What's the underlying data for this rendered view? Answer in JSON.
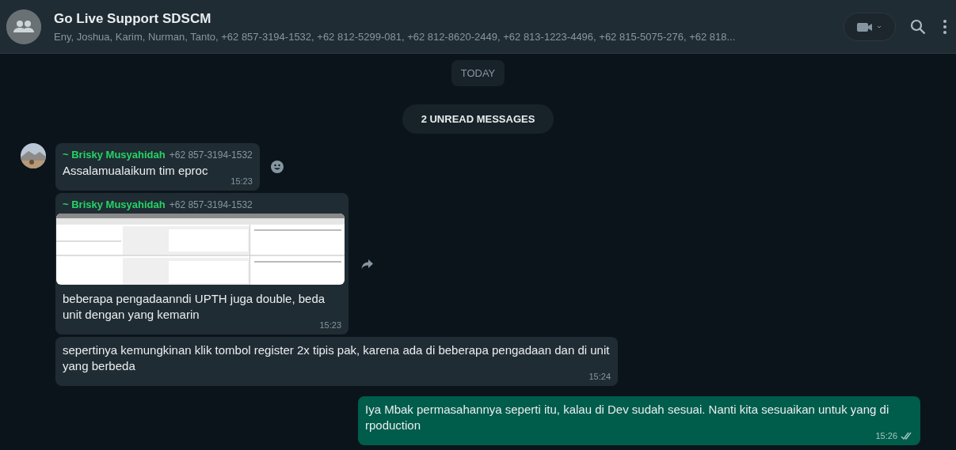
{
  "header": {
    "title": "Go Live Support SDSCM",
    "subtitle": "Eny, Joshua, Karim, Nurman, Tanto, +62 857-3194-1532, +62 812-5299-081, +62 812-8620-2449, +62 813-1223-4496, +62 815-5075-276, +62 818..."
  },
  "date_chip": "TODAY",
  "unread_banner": "2 UNREAD MESSAGES",
  "messages": [
    {
      "kind": "incoming",
      "avatar": true,
      "sender": "~ Brisky Musyahidah",
      "phone": "+62 857-3194-1532",
      "text": "Assalamualaikum tim eproc",
      "time": "15:23",
      "reaction_button": true
    },
    {
      "kind": "incoming",
      "avatar": false,
      "sender": "~ Brisky Musyahidah",
      "phone": "+62 857-3194-1532",
      "text": "beberapa pengadaanndi UPTH juga double, beda unit dengan yang kemarin",
      "time": "15:23",
      "forward_button": true
    },
    {
      "kind": "incoming",
      "avatar": false,
      "text": "sepertinya kemungkinan klik tombol register 2x tipis pak, karena ada di beberapa pengadaan dan di unit yang berbeda",
      "time": "15:24"
    },
    {
      "kind": "outgoing",
      "text": "Iya Mbak permasahannya seperti itu, kalau di Dev sudah sesuai. Nanti kita sesuaikan untuk yang di rpoduction",
      "time": "15:26",
      "read": false
    }
  ]
}
